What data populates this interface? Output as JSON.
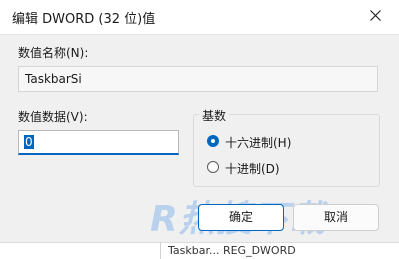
{
  "dialog": {
    "title": "编辑 DWORD (32 位)值"
  },
  "value_name": {
    "label": "数值名称(N):",
    "value": "TaskbarSi"
  },
  "value_data": {
    "label": "数值数据(V):",
    "value": "0"
  },
  "base": {
    "title": "基数",
    "options": [
      {
        "label": "十六进制(H)",
        "selected": true
      },
      {
        "label": "十进制(D)",
        "selected": false
      }
    ]
  },
  "buttons": {
    "ok": "确定",
    "cancel": "取消"
  },
  "watermark": {
    "text": "R热搜下载"
  },
  "background_list": {
    "fragment": "Taskbar... REG_DWORD"
  },
  "colors": {
    "accent": "#0067c0"
  }
}
